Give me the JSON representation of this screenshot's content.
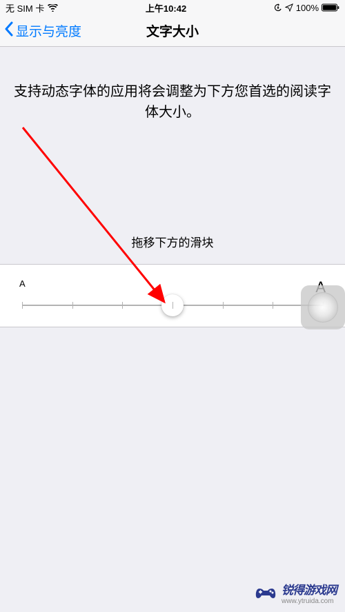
{
  "status_bar": {
    "carrier": "无 SIM 卡",
    "time": "上午10:42",
    "battery_percent": "100%"
  },
  "nav": {
    "back_label": "显示与亮度",
    "title": "文字大小"
  },
  "content": {
    "description": "支持动态字体的应用将会调整为下方您首选的阅读字体大小。",
    "instruction": "拖移下方的滑块"
  },
  "slider": {
    "label_small": "A",
    "label_large": "A",
    "ticks": 7,
    "position_percent": 50
  },
  "watermark": {
    "title": "锐得游戏网",
    "url": "www.ytruida.com"
  }
}
